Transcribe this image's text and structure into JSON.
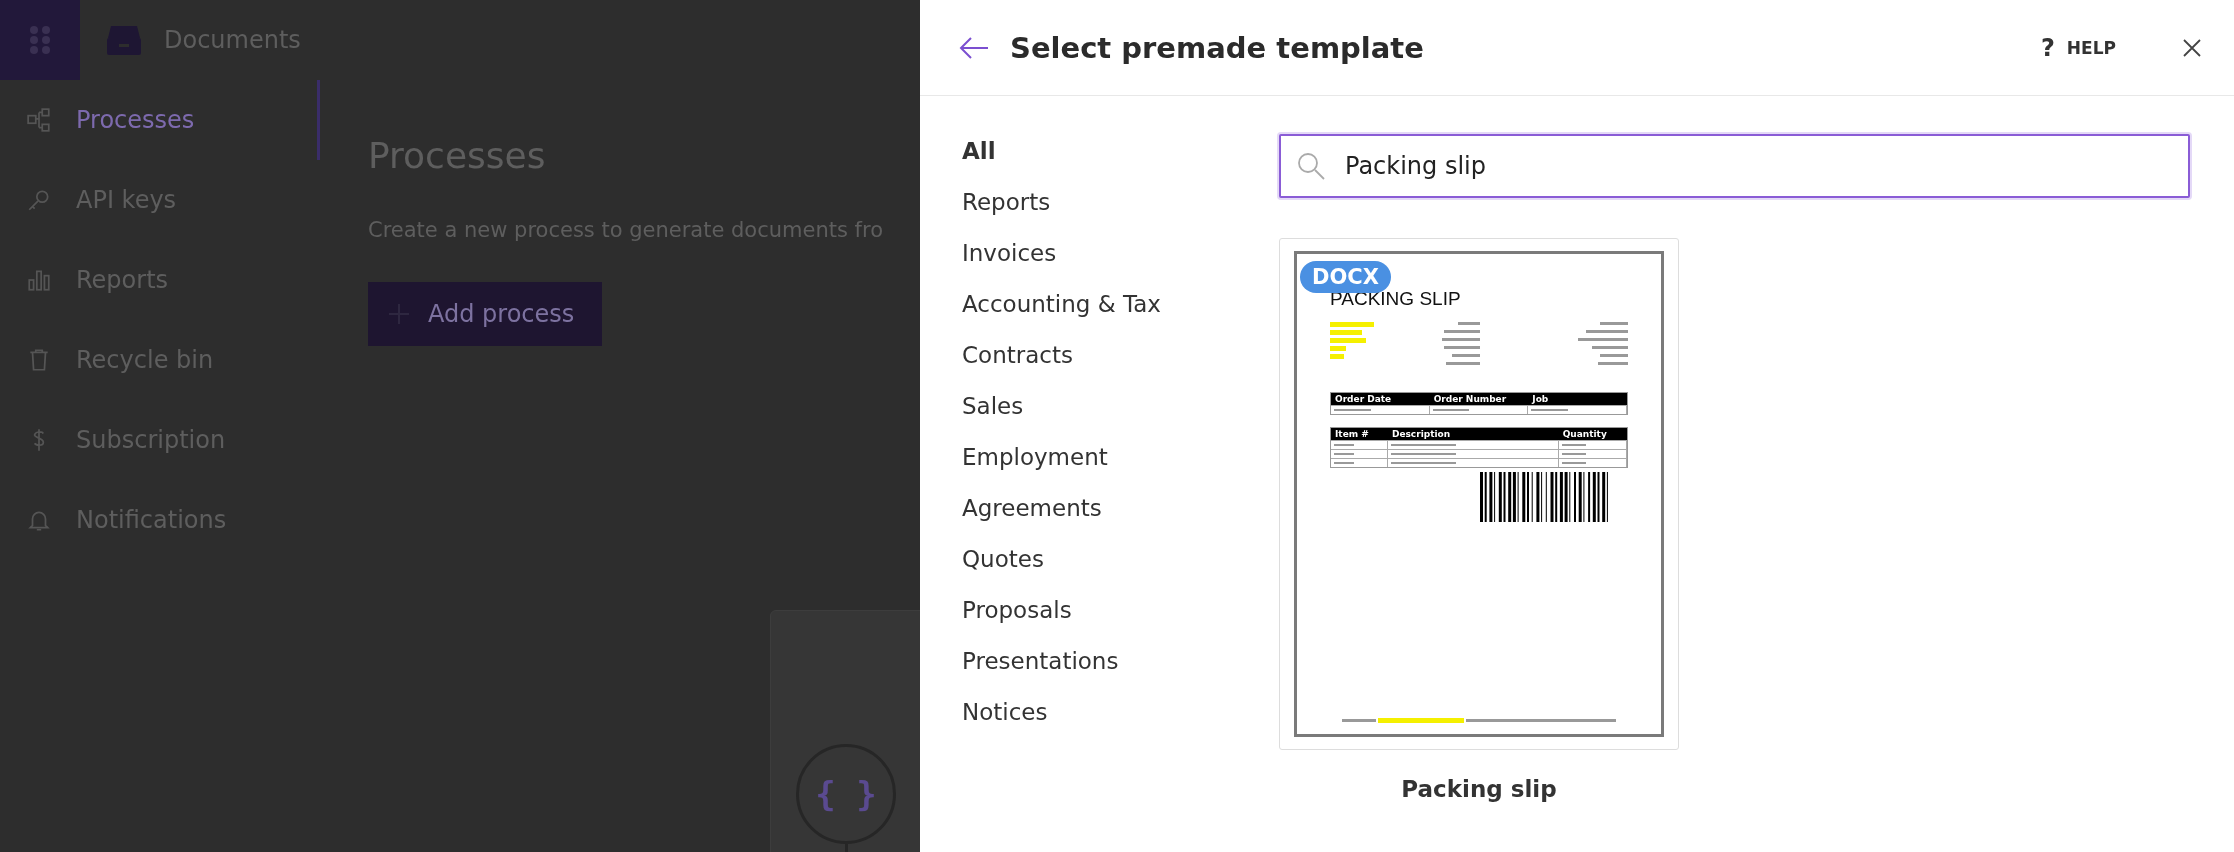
{
  "app": {
    "title": "Documents"
  },
  "sidebar": {
    "items": [
      {
        "label": "Processes",
        "selected": true
      },
      {
        "label": "API keys",
        "selected": false
      },
      {
        "label": "Reports",
        "selected": false
      },
      {
        "label": "Recycle bin",
        "selected": false
      },
      {
        "label": "Subscription",
        "selected": false
      },
      {
        "label": "Notifications",
        "selected": false
      }
    ]
  },
  "main": {
    "title": "Processes",
    "subtitle": "Create a new process to generate documents fro",
    "button": "Add process",
    "placeholder_icon": "{ }"
  },
  "panel": {
    "title": "Select premade template",
    "help": "HELP",
    "help_icon": "?",
    "categories": [
      {
        "label": "All",
        "selected": true
      },
      {
        "label": "Reports",
        "selected": false
      },
      {
        "label": "Invoices",
        "selected": false
      },
      {
        "label": "Accounting & Tax",
        "selected": false
      },
      {
        "label": "Contracts",
        "selected": false
      },
      {
        "label": "Sales",
        "selected": false
      },
      {
        "label": "Employment",
        "selected": false
      },
      {
        "label": "Agreements",
        "selected": false
      },
      {
        "label": "Quotes",
        "selected": false
      },
      {
        "label": "Proposals",
        "selected": false
      },
      {
        "label": "Presentations",
        "selected": false
      },
      {
        "label": "Notices",
        "selected": false
      }
    ],
    "search": {
      "value": "Packing slip"
    },
    "templates": [
      {
        "name": "Packing slip",
        "format": "DOCX",
        "doc_title": "PACKING SLIP",
        "table_1": [
          "Order Date",
          "Order Number",
          "Job"
        ],
        "table_2": [
          "Item #",
          "Description",
          "Quantity"
        ]
      }
    ]
  }
}
